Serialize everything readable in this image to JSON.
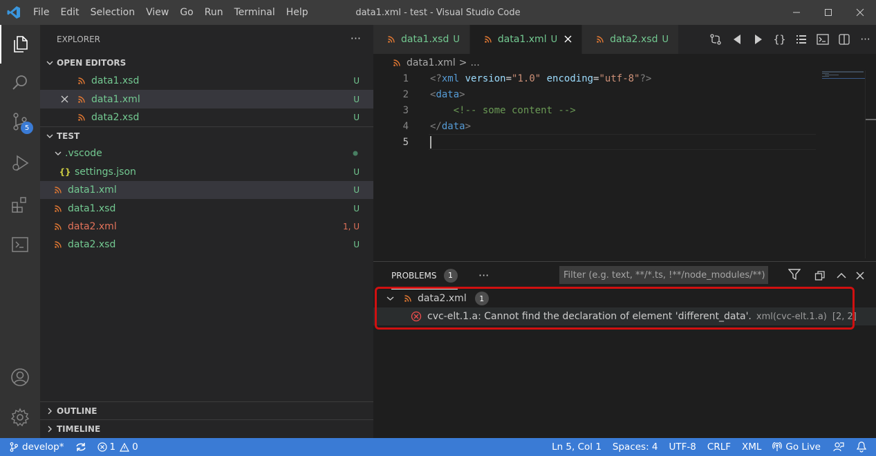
{
  "titlebar": {
    "menu": [
      "File",
      "Edit",
      "Selection",
      "View",
      "Go",
      "Run",
      "Terminal",
      "Help"
    ],
    "title": "data1.xml - test - Visual Studio Code"
  },
  "activity": {
    "scm_badge": "5"
  },
  "explorer": {
    "header": "EXPLORER",
    "more": "···",
    "open_editors": {
      "title": "OPEN EDITORS",
      "items": [
        {
          "name": "data1.xsd",
          "status": "U"
        },
        {
          "name": "data1.xml",
          "status": "U"
        },
        {
          "name": "data2.xsd",
          "status": "U"
        }
      ]
    },
    "folder": {
      "title": "TEST",
      "items": [
        {
          "name": ".vscode",
          "status": ""
        },
        {
          "name": "settings.json",
          "status": "U"
        },
        {
          "name": "data1.xml",
          "status": "U"
        },
        {
          "name": "data1.xsd",
          "status": "U"
        },
        {
          "name": "data2.xml",
          "status": "1, U"
        },
        {
          "name": "data2.xsd",
          "status": "U"
        }
      ]
    },
    "outline": "OUTLINE",
    "timeline": "TIMELINE"
  },
  "tabs": [
    {
      "name": "data1.xsd",
      "status": "U"
    },
    {
      "name": "data1.xml",
      "status": "U"
    },
    {
      "name": "data2.xsd",
      "status": "U"
    }
  ],
  "breadcrumb": {
    "file": "data1.xml",
    "sep": ">",
    "rest": "..."
  },
  "editor": {
    "line_numbers": [
      "1",
      "2",
      "3",
      "4",
      "5"
    ],
    "line1": {
      "open": "<?",
      "tag": "xml",
      "a1": " version",
      "eq1": "=",
      "v1": "\"1.0\"",
      "a2": " encoding",
      "eq2": "=",
      "v2": "\"utf-8\"",
      "close": "?>"
    },
    "line2": {
      "open": "<",
      "tag": "data",
      "close": ">"
    },
    "line3": {
      "comment": "    <!-- some content -->"
    },
    "line4": {
      "open": "</",
      "tag": "data",
      "close": ">"
    }
  },
  "panel": {
    "tab": "PROBLEMS",
    "count": "1",
    "more": "···",
    "filter_placeholder": "Filter (e.g. text, **/*.ts, !**/node_modules/**)",
    "file": {
      "name": "data2.xml",
      "count": "1"
    },
    "problem": {
      "message": "cvc-elt.1.a: Cannot find the declaration of element 'different_data'.",
      "source": "xml(cvc-elt.1.a)",
      "location": "[2, 2]"
    }
  },
  "statusbar": {
    "branch": "develop*",
    "errors": "1",
    "warnings": "0",
    "position": "Ln 5, Col 1",
    "spaces": "Spaces: 4",
    "encoding": "UTF-8",
    "eol": "CRLF",
    "language": "XML",
    "golive": "Go Live"
  },
  "colors": {
    "accent": "#3a7bd5",
    "untracked": "#73c991",
    "error": "#e2725a"
  }
}
